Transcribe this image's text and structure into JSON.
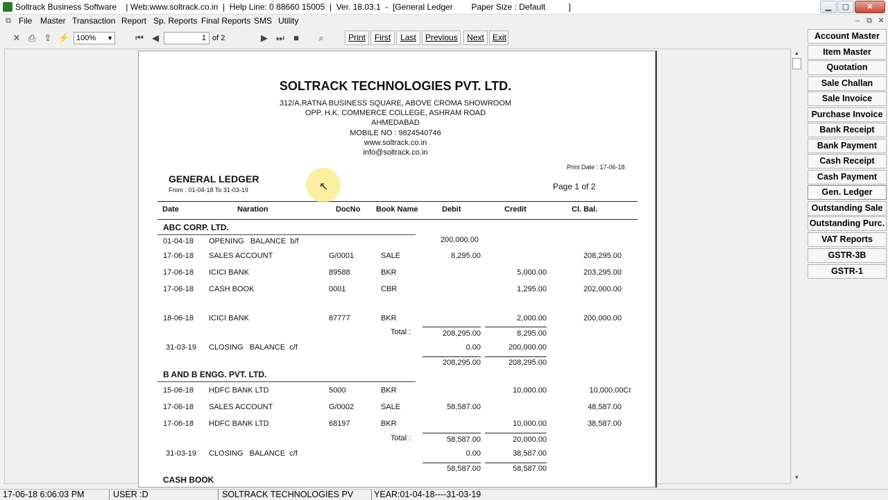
{
  "window": {
    "title": "Soltrack Business Software    | Web:www.soltrack.co.in  |  Help Line: 0 88660 15005  |  Ver. 18.03.1  -  [General Ledger        Paper Size : Default          ]",
    "controls": {
      "minimize": "▁",
      "maximize": "▢",
      "close": "✕"
    },
    "mdi_controls": {
      "minimize": "–",
      "restore": "⧉",
      "close": "✕"
    }
  },
  "menu": [
    "File",
    "Master",
    "Transaction",
    "Report",
    "Sp. Reports",
    "Final Reports",
    "SMS",
    "Utility"
  ],
  "toolbar": {
    "zoom": "100%",
    "page_current": "1",
    "page_total": "of 2",
    "buttons": [
      "Print",
      "First",
      "Last",
      "Previous",
      "Next",
      "Exit"
    ],
    "icons": [
      "close-icon",
      "print-icon",
      "export-icon",
      "lightning-icon",
      "first-page-icon",
      "prev-page-icon",
      "next-page-icon",
      "last-page-icon",
      "stop-icon",
      "search-binoculars-icon"
    ]
  },
  "right_panel": [
    "Account Master",
    "Item Master",
    "Quotation",
    "Sale Challan",
    "Sale Invoice",
    "Purchase Invoice",
    "Bank Receipt",
    "Bank Payment",
    "Cash Receipt",
    "Cash Payment",
    "Gen. Ledger",
    "Outstanding Sale",
    "Outstanding Purc.",
    "VAT Reports",
    "GSTR-3B",
    "GSTR-1"
  ],
  "report": {
    "company": "SOLTRACK TECHNOLOGIES PVT. LTD.",
    "address": [
      "312/A,RATNA BUSINESS SQUARE, ABOVE CROMA SHOWROOM",
      "OPP. H.K. COMMERCE COLLEGE, ASHRAM ROAD",
      "AHMEDABAD",
      "MOBILE NO : 9824540746",
      "www.soltrack.co.in",
      "info@soltrack.co.in"
    ],
    "print_date": "Print Date : 17-06-18",
    "title": "GENERAL LEDGER",
    "period": "From : 01-04-18  To  31-03-19",
    "page": "Page 1 of 2",
    "columns": [
      "Date",
      "Naration",
      "DocNo",
      "Book Name",
      "Debit",
      "Credit",
      "Cl. Bal."
    ],
    "sections": [
      {
        "name": "ABC CORP. LTD.",
        "rows": [
          {
            "date": "01-04-18",
            "narration": "OPENING   BALANCE  b/f",
            "docno": "",
            "book": "",
            "debit": "200,000.00",
            "credit": "",
            "bal": ""
          },
          {
            "date": "17-06-18",
            "narration": "SALES ACCOUNT",
            "docno": "G/0001",
            "book": "SALE",
            "debit": "8,295.00",
            "credit": "",
            "bal": "208,295.00"
          },
          {
            "date": "17-06-18",
            "narration": "ICICI BANK",
            "docno": "89588",
            "book": "BKR",
            "debit": "",
            "credit": "5,000.00",
            "bal": "203,295.00"
          },
          {
            "date": "17-06-18",
            "narration": "CASH BOOK",
            "docno": "0001",
            "book": "CBR",
            "debit": "",
            "credit": "1,295.00",
            "bal": "202,000.00"
          },
          {
            "date": "18-06-18",
            "narration": "ICICI BANK",
            "docno": "87777",
            "book": "BKR",
            "debit": "",
            "credit": "2,000.00",
            "bal": "200,000.00"
          }
        ],
        "total_label": "Total :",
        "total": {
          "debit": "208,295.00",
          "credit": "8,295.00"
        },
        "closing": {
          "date": "31-03-19",
          "narration": "CLOSING   BALANCE  c/f",
          "debit": "0.00",
          "credit": "200,000.00"
        },
        "grand": {
          "debit": "208,295.00",
          "credit": "208,295.00"
        }
      },
      {
        "name": "B AND B ENGG. PVT. LTD.",
        "rows": [
          {
            "date": "15-06-18",
            "narration": "HDFC BANK LTD",
            "docno": "5000",
            "book": "BKR",
            "debit": "",
            "credit": "10,000.00",
            "bal": "10,000.00Cr"
          },
          {
            "date": "17-06-18",
            "narration": "SALES ACCOUNT",
            "docno": "G/0002",
            "book": "SALE",
            "debit": "58,587.00",
            "credit": "",
            "bal": "48,587.00"
          },
          {
            "date": "17-06-18",
            "narration": "HDFC BANK LTD",
            "docno": "68197",
            "book": "BKR",
            "debit": "",
            "credit": "10,000.00",
            "bal": "38,587.00"
          }
        ],
        "total_label": "Total :",
        "total": {
          "debit": "58,587.00",
          "credit": "20,000.00"
        },
        "closing": {
          "date": "31-03-19",
          "narration": "CLOSING   BALANCE  c/f",
          "debit": "0.00",
          "credit": "38,587.00"
        },
        "grand": {
          "debit": "58,587.00",
          "credit": "58,587.00"
        }
      },
      {
        "name": "CASH BOOK"
      }
    ]
  },
  "status": {
    "datetime": "17-06-18 6:06:03 PM",
    "user": "USER :D",
    "company": "SOLTRACK TECHNOLOGIES PV",
    "year": "YEAR:01-04-18----31-03-19"
  }
}
